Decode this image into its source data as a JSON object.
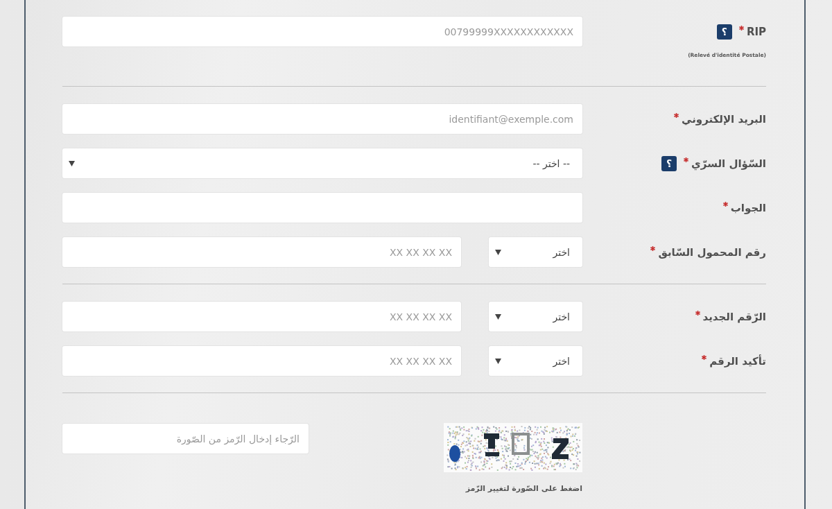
{
  "form": {
    "sections": [
      {
        "fields": [
          {
            "kind": "text",
            "label": "RIP",
            "required": true,
            "help": "؟",
            "note": "(Relevé d'identité Postale)",
            "placeholder": "00799999XXXXXXXXXXXX"
          }
        ]
      },
      {
        "fields": [
          {
            "kind": "text",
            "label": "البريد الإلكتروني",
            "required": true,
            "placeholder": "identifiant@exemple.com"
          },
          {
            "kind": "select",
            "label": "السّؤال السرّي",
            "required": true,
            "help": "؟",
            "value": "-- اختر --"
          },
          {
            "kind": "text",
            "label": "الجواب",
            "required": true
          },
          {
            "kind": "phone",
            "label": "رقم المحمول السّابق",
            "required": true,
            "prefix": "اختر",
            "placeholder": "XX XX XX XX"
          }
        ]
      },
      {
        "fields": [
          {
            "kind": "phone",
            "label": "الرّقم الجديد",
            "required": true,
            "prefix": "اختر",
            "placeholder": "XX XX XX XX"
          },
          {
            "kind": "phone",
            "label": "تأكيد الرقم",
            "required": true,
            "prefix": "اختر",
            "placeholder": "XX XX XX XX"
          }
        ]
      },
      {
        "fields": [
          {
            "kind": "captcha",
            "placeholder": "الرّجاء إدخال الرّمز من الصّورة",
            "caption": "اضغط على الصّورة لتغيير الرّمز"
          }
        ]
      }
    ]
  }
}
